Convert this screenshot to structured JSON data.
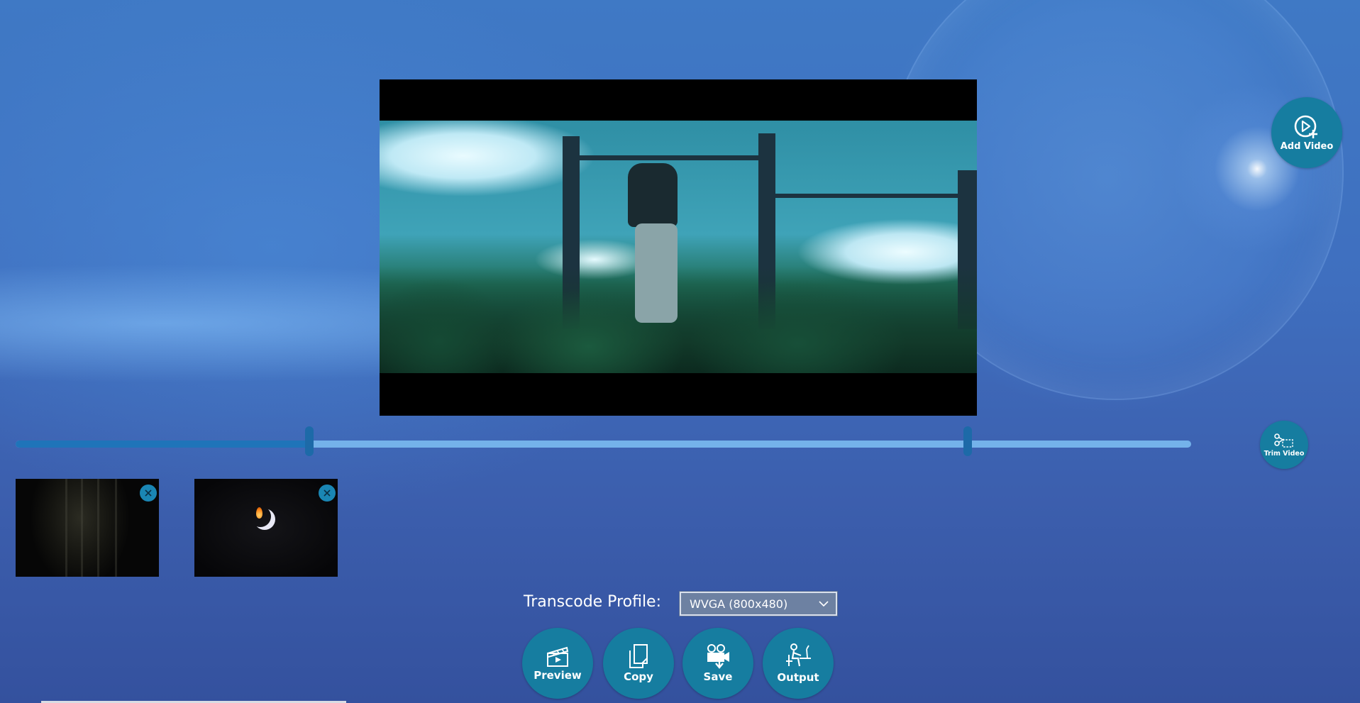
{
  "app": {
    "accent_color": "#167da0",
    "background_color": "#3f6fbf"
  },
  "player": {
    "icon": "video-frame-still"
  },
  "actions": {
    "add_video_label": "Add Video",
    "add_video_icon": "play-circle-plus-icon",
    "trim_video_label": "Trim Video",
    "trim_video_icon": "scissors-icon"
  },
  "timeline": {
    "trim_start_fraction": 0.25,
    "trim_end_fraction": 0.81,
    "accent_fill_color": "#1f74b9",
    "track_color": "#74b2ea"
  },
  "clips": [
    {
      "name": "clip-dark-forest",
      "remove_icon": "close-icon"
    },
    {
      "name": "clip-fire-crescent",
      "remove_icon": "close-icon"
    }
  ],
  "transcode": {
    "label": "Transcode Profile:",
    "selected": "WVGA (800x480)"
  },
  "toolbar": {
    "preview_label": "Preview",
    "preview_icon": "clapperboard-icon",
    "copy_label": "Copy",
    "copy_icon": "copy-icon",
    "save_label": "Save",
    "save_icon": "video-camera-save-icon",
    "output_label": "Output",
    "output_icon": "person-at-desk-icon"
  }
}
